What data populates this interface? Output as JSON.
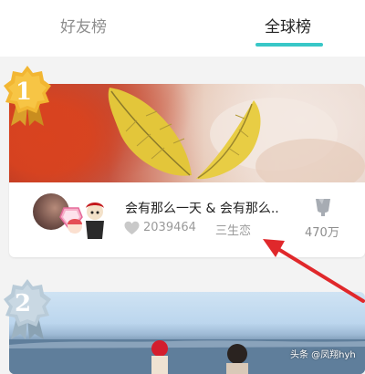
{
  "tabs": [
    {
      "label": "好友榜",
      "active": false
    },
    {
      "label": "全球榜",
      "active": true
    }
  ],
  "accent_color": "#38c7c7",
  "annotation_color": "#e0282b",
  "entries": [
    {
      "rank": "1",
      "rank_badge": "gold-medal",
      "title": "会有那么一天 & 会有那么..",
      "likes": "2039464",
      "category": "三生恋",
      "gift_count": "470万",
      "icons": [
        "heart-icon",
        "cup-icon"
      ]
    },
    {
      "rank": "2",
      "rank_badge": "silver-medal"
    }
  ],
  "watermark": "头条 @凤翔hyh"
}
